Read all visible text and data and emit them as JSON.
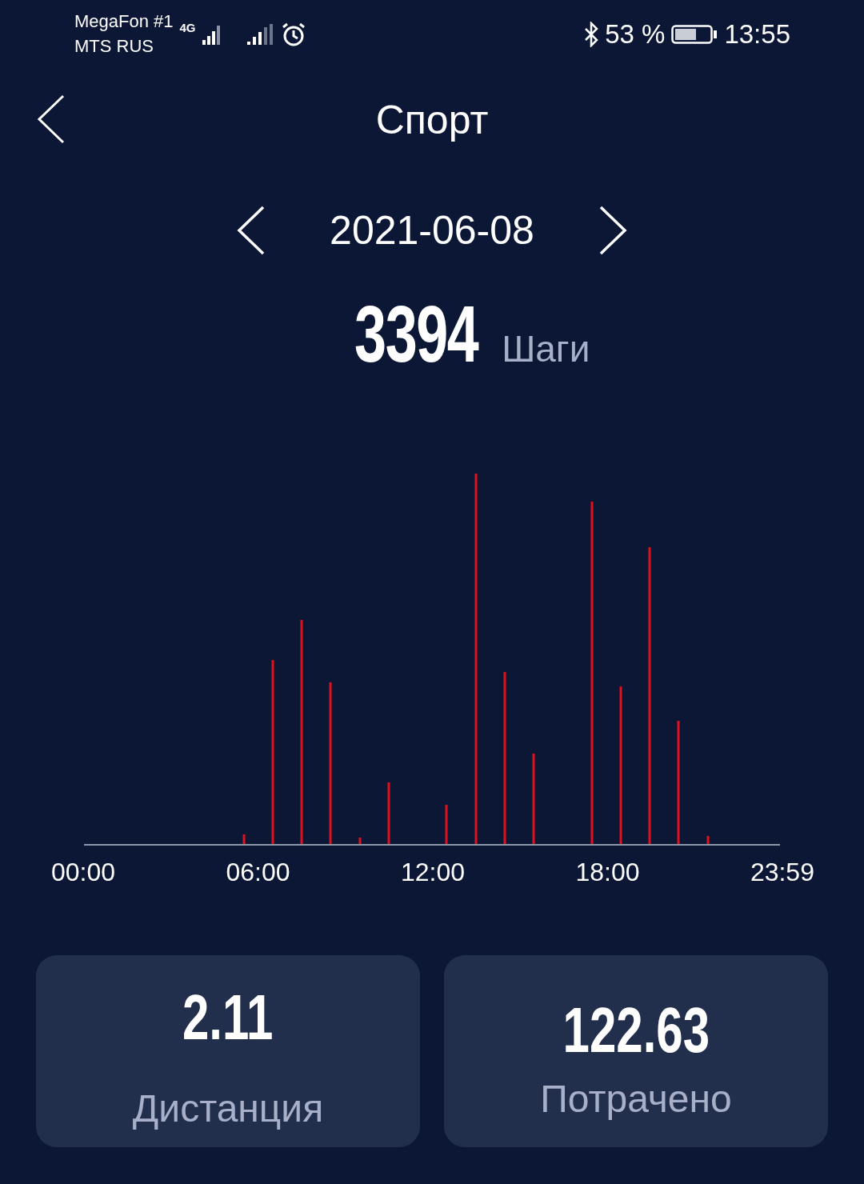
{
  "status_bar": {
    "carriers": [
      "MegaFon #1",
      "MTS RUS"
    ],
    "network_type": "4G",
    "battery": "53 %",
    "time": "13:55"
  },
  "header": {
    "title": "Спорт"
  },
  "date_nav": {
    "date": "2021-06-08"
  },
  "steps": {
    "value": "3394",
    "unit": "Шаги"
  },
  "chart": {
    "x_labels": [
      "00:00",
      "06:00",
      "12:00",
      "18:00",
      "23:59"
    ]
  },
  "stats": [
    {
      "value": "2.11",
      "label": "Дистанция"
    },
    {
      "value": "122.63",
      "label": "Потрачено"
    }
  ]
}
